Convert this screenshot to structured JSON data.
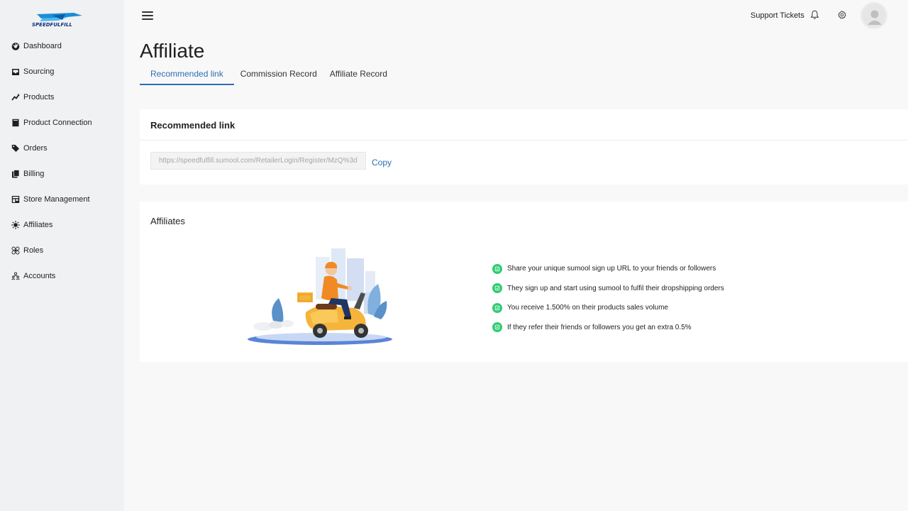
{
  "brand": {
    "logo_text": "SPEEDFULFILL",
    "accent_color": "#2d6fb3",
    "logo_colors": [
      "#1c8ed6",
      "#0b2f79"
    ]
  },
  "sidebar": {
    "items": [
      {
        "label": "Dashboard",
        "icon": "dashboard-icon"
      },
      {
        "label": "Sourcing",
        "icon": "inbox-icon"
      },
      {
        "label": "Products",
        "icon": "trend-icon"
      },
      {
        "label": "Product Connection",
        "icon": "book-icon"
      },
      {
        "label": "Orders",
        "icon": "tags-icon"
      },
      {
        "label": "Billing",
        "icon": "copy-icon"
      },
      {
        "label": "Store Management",
        "icon": "store-icon"
      },
      {
        "label": "Affiliates",
        "icon": "sun-icon"
      },
      {
        "label": "Roles",
        "icon": "roles-icon"
      },
      {
        "label": "Accounts",
        "icon": "accounts-icon"
      }
    ]
  },
  "header": {
    "support_label": "Support Tickets",
    "icons": [
      "menu-icon",
      "bell-icon",
      "gear-icon",
      "avatar-icon"
    ]
  },
  "page": {
    "title": "Affiliate",
    "tabs": [
      {
        "label": "Recommended link",
        "active": true
      },
      {
        "label": "Commission Record",
        "active": false
      },
      {
        "label": "Affiliate Record",
        "active": false
      }
    ]
  },
  "recommended": {
    "heading": "Recommended link",
    "url": "https://speedfulfill.sumool.com/RetailerLogin/Register/MzQ%3d",
    "copy_label": "Copy"
  },
  "affiliates": {
    "heading": "Affiliates",
    "check_color": "#2ecc71",
    "benefits": [
      "Share your unique sumool sign up URL to your friends or followers",
      "They sign up and start using sumool to fulfil their dropshipping orders",
      "You receive 1.500% on their products sales volume",
      "If they refer their friends or followers you get an extra 0.5%"
    ]
  }
}
